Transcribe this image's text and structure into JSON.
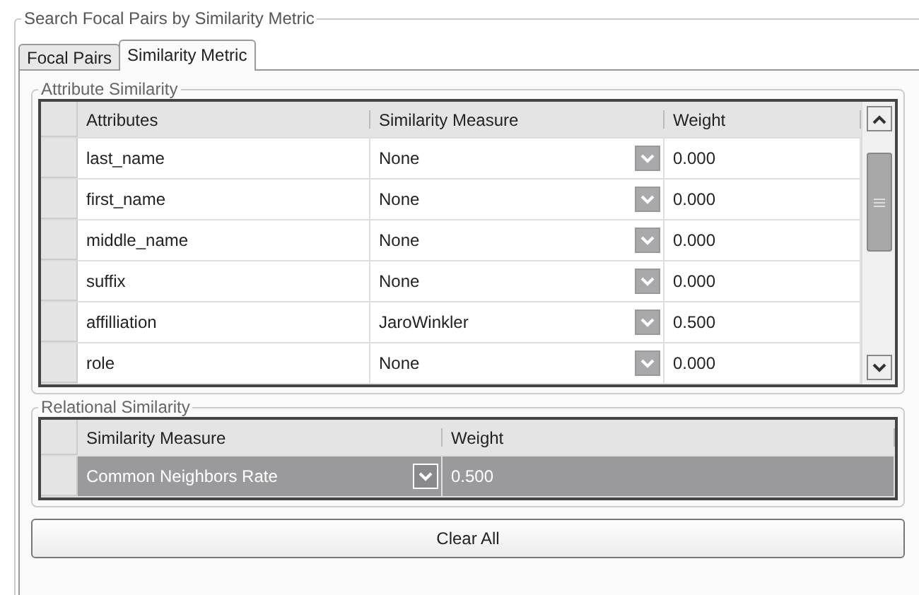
{
  "group_title": "Search Focal Pairs by Similarity Metric",
  "tabs": [
    {
      "label": "Focal Pairs",
      "selected": false
    },
    {
      "label": "Similarity Metric",
      "selected": true
    }
  ],
  "attribute_similarity": {
    "title": "Attribute Similarity",
    "columns": [
      "Attributes",
      "Similarity Measure",
      "Weight"
    ],
    "rows": [
      {
        "attribute": "last_name",
        "measure": "None",
        "weight": "0.000",
        "selected": false
      },
      {
        "attribute": "first_name",
        "measure": "None",
        "weight": "0.000",
        "selected": false
      },
      {
        "attribute": "middle_name",
        "measure": "None",
        "weight": "0.000",
        "selected": false
      },
      {
        "attribute": "suffix",
        "measure": "None",
        "weight": "0.000",
        "selected": false
      },
      {
        "attribute": "affilliation",
        "measure": "JaroWinkler",
        "weight": "0.500",
        "selected": false
      },
      {
        "attribute": "role",
        "measure": "None",
        "weight": "0.000",
        "selected": false
      }
    ]
  },
  "relational_similarity": {
    "title": "Relational Similarity",
    "columns": [
      "Similarity Measure",
      "Weight"
    ],
    "rows": [
      {
        "measure": "Common Neighbors Rate",
        "weight": "0.500",
        "selected": true
      }
    ]
  },
  "buttons": [
    "Clear All"
  ]
}
